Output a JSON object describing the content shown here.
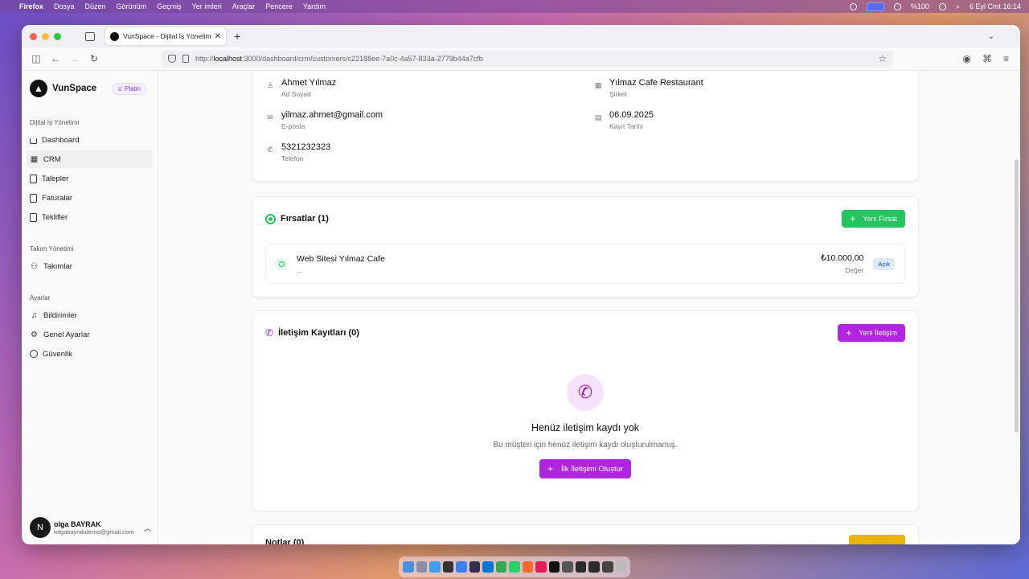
{
  "menubar": {
    "app": "Firefox",
    "items": [
      "Dosya",
      "Düzen",
      "Görünüm",
      "Geçmiş",
      "Yer imleri",
      "Araçlar",
      "Pencere",
      "Yardım"
    ],
    "battery": "%100",
    "datetime": "6 Eyl Cmt  16:14"
  },
  "browser": {
    "tab_title": "VunSpace - Dijital İş Yönetimi P",
    "url_prefix": "http://",
    "url_host": "localhost",
    "url_rest": ":3000/dashboard/crm/customers/c22188ee-7a0c-4a57-833a-2779b44a7cfb"
  },
  "sidebar": {
    "brand": "VunSpace",
    "plan_badge": "♕ Platin",
    "sections": [
      {
        "title": "Dijital İş Yönetimi",
        "items": [
          "Dashboard",
          "CRM",
          "Talepler",
          "Faturalar",
          "Teklifler"
        ]
      },
      {
        "title": "Takım Yönetimi",
        "items": [
          "Takımlar"
        ]
      },
      {
        "title": "Ayarlar",
        "items": [
          "Bildirimler",
          "Genel Ayarlar",
          "Güvenlik"
        ]
      }
    ],
    "user": {
      "initial": "N",
      "name": "olga BAYRAK",
      "email": "tolgabayrakdemo@gmail.com"
    }
  },
  "customer": {
    "name": "Ahmet Yılmaz",
    "name_label": "Ad Soyad",
    "email": "yilmaz.ahmet@gmail.com",
    "email_label": "E-posta",
    "phone": "5321232323",
    "phone_label": "Telefon",
    "company": "Yılmaz Cafe Restaurant",
    "company_label": "Şirket",
    "date": "06.09.2025",
    "date_label": "Kayıt Tarihi"
  },
  "opportunities": {
    "title": "Fırsatlar (1)",
    "new_button": "Yeni Fırsat",
    "items": [
      {
        "name": "Web Sitesi Yılmaz Cafe",
        "sub": "...",
        "amount": "₺10.000,00",
        "amount_label": "Değer",
        "status": "Açık"
      }
    ]
  },
  "communications": {
    "title": "İletişim Kayıtları (0)",
    "new_button": "Yeni İletişim",
    "empty_title": "Henüz iletişim kaydı yok",
    "empty_sub": "Bu müşteri için henüz iletişim kaydı oluşturulmamış.",
    "empty_button": "İlk İletişimi Oluştur"
  },
  "notes": {
    "title": "Notlar (0)"
  },
  "colors": {
    "green": "#22c55e",
    "purple": "#b026e0",
    "yellow": "#eab308"
  }
}
